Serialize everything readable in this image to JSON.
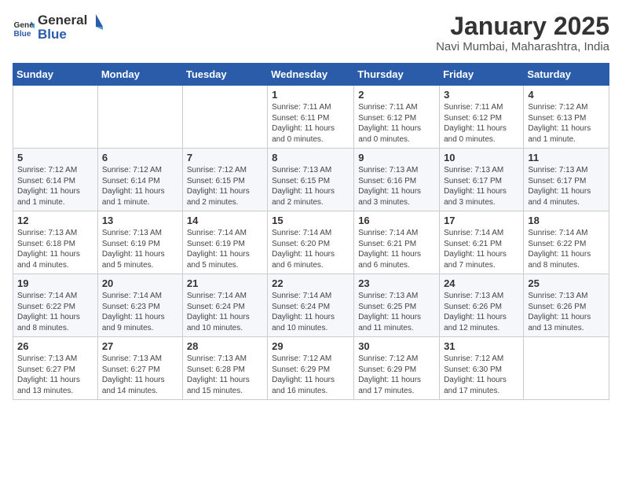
{
  "header": {
    "logo_general": "General",
    "logo_blue": "Blue",
    "title": "January 2025",
    "subtitle": "Navi Mumbai, Maharashtra, India"
  },
  "columns": [
    "Sunday",
    "Monday",
    "Tuesday",
    "Wednesday",
    "Thursday",
    "Friday",
    "Saturday"
  ],
  "weeks": [
    [
      {
        "day": "",
        "sunrise": "",
        "sunset": "",
        "daylight": ""
      },
      {
        "day": "",
        "sunrise": "",
        "sunset": "",
        "daylight": ""
      },
      {
        "day": "",
        "sunrise": "",
        "sunset": "",
        "daylight": ""
      },
      {
        "day": "1",
        "sunrise": "Sunrise: 7:11 AM",
        "sunset": "Sunset: 6:11 PM",
        "daylight": "Daylight: 11 hours and 0 minutes."
      },
      {
        "day": "2",
        "sunrise": "Sunrise: 7:11 AM",
        "sunset": "Sunset: 6:12 PM",
        "daylight": "Daylight: 11 hours and 0 minutes."
      },
      {
        "day": "3",
        "sunrise": "Sunrise: 7:11 AM",
        "sunset": "Sunset: 6:12 PM",
        "daylight": "Daylight: 11 hours and 0 minutes."
      },
      {
        "day": "4",
        "sunrise": "Sunrise: 7:12 AM",
        "sunset": "Sunset: 6:13 PM",
        "daylight": "Daylight: 11 hours and 1 minute."
      }
    ],
    [
      {
        "day": "5",
        "sunrise": "Sunrise: 7:12 AM",
        "sunset": "Sunset: 6:14 PM",
        "daylight": "Daylight: 11 hours and 1 minute."
      },
      {
        "day": "6",
        "sunrise": "Sunrise: 7:12 AM",
        "sunset": "Sunset: 6:14 PM",
        "daylight": "Daylight: 11 hours and 1 minute."
      },
      {
        "day": "7",
        "sunrise": "Sunrise: 7:12 AM",
        "sunset": "Sunset: 6:15 PM",
        "daylight": "Daylight: 11 hours and 2 minutes."
      },
      {
        "day": "8",
        "sunrise": "Sunrise: 7:13 AM",
        "sunset": "Sunset: 6:15 PM",
        "daylight": "Daylight: 11 hours and 2 minutes."
      },
      {
        "day": "9",
        "sunrise": "Sunrise: 7:13 AM",
        "sunset": "Sunset: 6:16 PM",
        "daylight": "Daylight: 11 hours and 3 minutes."
      },
      {
        "day": "10",
        "sunrise": "Sunrise: 7:13 AM",
        "sunset": "Sunset: 6:17 PM",
        "daylight": "Daylight: 11 hours and 3 minutes."
      },
      {
        "day": "11",
        "sunrise": "Sunrise: 7:13 AM",
        "sunset": "Sunset: 6:17 PM",
        "daylight": "Daylight: 11 hours and 4 minutes."
      }
    ],
    [
      {
        "day": "12",
        "sunrise": "Sunrise: 7:13 AM",
        "sunset": "Sunset: 6:18 PM",
        "daylight": "Daylight: 11 hours and 4 minutes."
      },
      {
        "day": "13",
        "sunrise": "Sunrise: 7:13 AM",
        "sunset": "Sunset: 6:19 PM",
        "daylight": "Daylight: 11 hours and 5 minutes."
      },
      {
        "day": "14",
        "sunrise": "Sunrise: 7:14 AM",
        "sunset": "Sunset: 6:19 PM",
        "daylight": "Daylight: 11 hours and 5 minutes."
      },
      {
        "day": "15",
        "sunrise": "Sunrise: 7:14 AM",
        "sunset": "Sunset: 6:20 PM",
        "daylight": "Daylight: 11 hours and 6 minutes."
      },
      {
        "day": "16",
        "sunrise": "Sunrise: 7:14 AM",
        "sunset": "Sunset: 6:21 PM",
        "daylight": "Daylight: 11 hours and 6 minutes."
      },
      {
        "day": "17",
        "sunrise": "Sunrise: 7:14 AM",
        "sunset": "Sunset: 6:21 PM",
        "daylight": "Daylight: 11 hours and 7 minutes."
      },
      {
        "day": "18",
        "sunrise": "Sunrise: 7:14 AM",
        "sunset": "Sunset: 6:22 PM",
        "daylight": "Daylight: 11 hours and 8 minutes."
      }
    ],
    [
      {
        "day": "19",
        "sunrise": "Sunrise: 7:14 AM",
        "sunset": "Sunset: 6:22 PM",
        "daylight": "Daylight: 11 hours and 8 minutes."
      },
      {
        "day": "20",
        "sunrise": "Sunrise: 7:14 AM",
        "sunset": "Sunset: 6:23 PM",
        "daylight": "Daylight: 11 hours and 9 minutes."
      },
      {
        "day": "21",
        "sunrise": "Sunrise: 7:14 AM",
        "sunset": "Sunset: 6:24 PM",
        "daylight": "Daylight: 11 hours and 10 minutes."
      },
      {
        "day": "22",
        "sunrise": "Sunrise: 7:14 AM",
        "sunset": "Sunset: 6:24 PM",
        "daylight": "Daylight: 11 hours and 10 minutes."
      },
      {
        "day": "23",
        "sunrise": "Sunrise: 7:13 AM",
        "sunset": "Sunset: 6:25 PM",
        "daylight": "Daylight: 11 hours and 11 minutes."
      },
      {
        "day": "24",
        "sunrise": "Sunrise: 7:13 AM",
        "sunset": "Sunset: 6:26 PM",
        "daylight": "Daylight: 11 hours and 12 minutes."
      },
      {
        "day": "25",
        "sunrise": "Sunrise: 7:13 AM",
        "sunset": "Sunset: 6:26 PM",
        "daylight": "Daylight: 11 hours and 13 minutes."
      }
    ],
    [
      {
        "day": "26",
        "sunrise": "Sunrise: 7:13 AM",
        "sunset": "Sunset: 6:27 PM",
        "daylight": "Daylight: 11 hours and 13 minutes."
      },
      {
        "day": "27",
        "sunrise": "Sunrise: 7:13 AM",
        "sunset": "Sunset: 6:27 PM",
        "daylight": "Daylight: 11 hours and 14 minutes."
      },
      {
        "day": "28",
        "sunrise": "Sunrise: 7:13 AM",
        "sunset": "Sunset: 6:28 PM",
        "daylight": "Daylight: 11 hours and 15 minutes."
      },
      {
        "day": "29",
        "sunrise": "Sunrise: 7:12 AM",
        "sunset": "Sunset: 6:29 PM",
        "daylight": "Daylight: 11 hours and 16 minutes."
      },
      {
        "day": "30",
        "sunrise": "Sunrise: 7:12 AM",
        "sunset": "Sunset: 6:29 PM",
        "daylight": "Daylight: 11 hours and 17 minutes."
      },
      {
        "day": "31",
        "sunrise": "Sunrise: 7:12 AM",
        "sunset": "Sunset: 6:30 PM",
        "daylight": "Daylight: 11 hours and 17 minutes."
      },
      {
        "day": "",
        "sunrise": "",
        "sunset": "",
        "daylight": ""
      }
    ]
  ]
}
